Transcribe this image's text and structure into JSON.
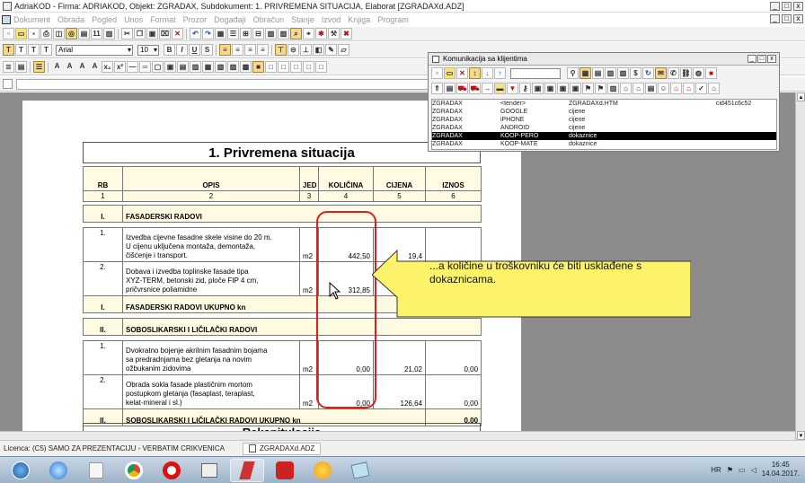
{
  "window": {
    "title": "AdriaKOD - Firma: ADRIAKOD,  Objekt: ZGRADAX,  Subdokument: 1. PRIVREMENA SITUACIJA,  Elaborat [ZGRADAXd.ADZ]",
    "min": "_",
    "max": "□",
    "close": "x"
  },
  "menu": [
    "Dokument",
    "Obrada",
    "Pogled",
    "Unos",
    "Format",
    "Prozor",
    "Događaji",
    "Obračun",
    "Stanje",
    "Izvod",
    "Knjiga",
    "Program"
  ],
  "format": {
    "font": "Arial",
    "size": "10"
  },
  "document": {
    "title": "1. Privremena situacija",
    "columns": [
      "RB",
      "OPIS",
      "JED",
      "KOLIČINA",
      "CIJENA",
      "IZNOS"
    ],
    "colnums": [
      "1",
      "2",
      "3",
      "4",
      "5",
      "6"
    ],
    "sec1": {
      "rb": "I.",
      "name": "FASADERSKI RADOVI",
      "total": "FASADERSKI RADOVI UKUPNO kn"
    },
    "sec1_items": [
      {
        "rb": "1.",
        "opis": "Izvedba cijevne fasadne skele visine do 20 m.\nU cijenu uključena montaža, demontaža,\nčišćenje i transport.",
        "jed": "m2",
        "kol": "442,50",
        "cij": "19,4"
      },
      {
        "rb": "2.",
        "opis": "Dobava i izvedba toplinske fasade tipa\nXYZ-TERM, betonski zid, ploče FIP 4 cm,\npričvrsnice poliamidne",
        "jed": "m2",
        "kol": "312,85",
        "cij": "158,7"
      }
    ],
    "sec2": {
      "rb": "II.",
      "name": "SOBOSLIKARSKI I LIČILAČKI RADOVI",
      "total": "SOBOSLIKARSKI I LIČILAČKI RADOVI UKUPNO kn",
      "total_val": "0,00"
    },
    "sec2_items": [
      {
        "rb": "1.",
        "opis": "Dvokratno bojenje akrilnim fasadnim bojama\nsa predradnjama bez gletanja na novim\nožbukanim zidovima",
        "jed": "m2",
        "kol": "0,00",
        "cij": "21,02",
        "izn": "0,00"
      },
      {
        "rb": "2.",
        "opis": "Obrada sokla fasade plastičnim mortom\npostupkom gletanja (fasaplast, teraplast,\nkelat-mineral i sl.)",
        "jed": "m2",
        "kol": "0,00",
        "cij": "126,64",
        "izn": "0,00"
      }
    ],
    "next_heading": "Rekapitulacija"
  },
  "callout": {
    "text": "...a količine u troškovniku će biti usklađene s dokaznicama."
  },
  "komunikacija": {
    "title": "Komunikacija sa klijentima",
    "rows": [
      {
        "c1": "ZGRADAX",
        "c2": "<tender>",
        "c3": "ZGRADAXd.HTM",
        "c4": "cid451c6c52"
      },
      {
        "c1": "ZGRADAX",
        "c2": "GOOGLE",
        "c3": "cijene",
        "c4": ""
      },
      {
        "c1": "ZGRADAX",
        "c2": "iPHONE",
        "c3": "cijene",
        "c4": ""
      },
      {
        "c1": "ZGRADAX",
        "c2": "ANDROID",
        "c3": "cijene",
        "c4": ""
      },
      {
        "c1": "ZGRADAX",
        "c2": "KOOP-PERO",
        "c3": "dokaznice",
        "c4": ""
      },
      {
        "c1": "ZGRADAX",
        "c2": "KOOP-MATE",
        "c3": "dokaznice",
        "c4": ""
      }
    ]
  },
  "status": {
    "licence": "Licenca:  (C5) SAMO ZA PREZENTACIJU - VERBATIM CRIKVENICA",
    "doc": "ZGRADAXd.ADZ"
  },
  "tray": {
    "lang": "HR",
    "time": "16:45",
    "date": "14.04.2017."
  },
  "colors": {
    "accent_red": "#e21c1c",
    "callout": "#fdf36a",
    "editor_bg": "#8c8c8c",
    "selected_row": "#000000"
  },
  "icons": [
    "new-doc-icon",
    "open-folder-icon",
    "save-icon",
    "print-icon",
    "cut-icon",
    "copy-icon",
    "paste-icon",
    "undo-icon",
    "redo-icon",
    "bold-icon",
    "italic-icon",
    "underline-icon",
    "align-left-icon",
    "align-center-icon",
    "align-right-icon",
    "binoculars-icon",
    "globe-icon",
    "windows-start-icon",
    "ie-icon",
    "chrome-icon",
    "opera-icon"
  ]
}
